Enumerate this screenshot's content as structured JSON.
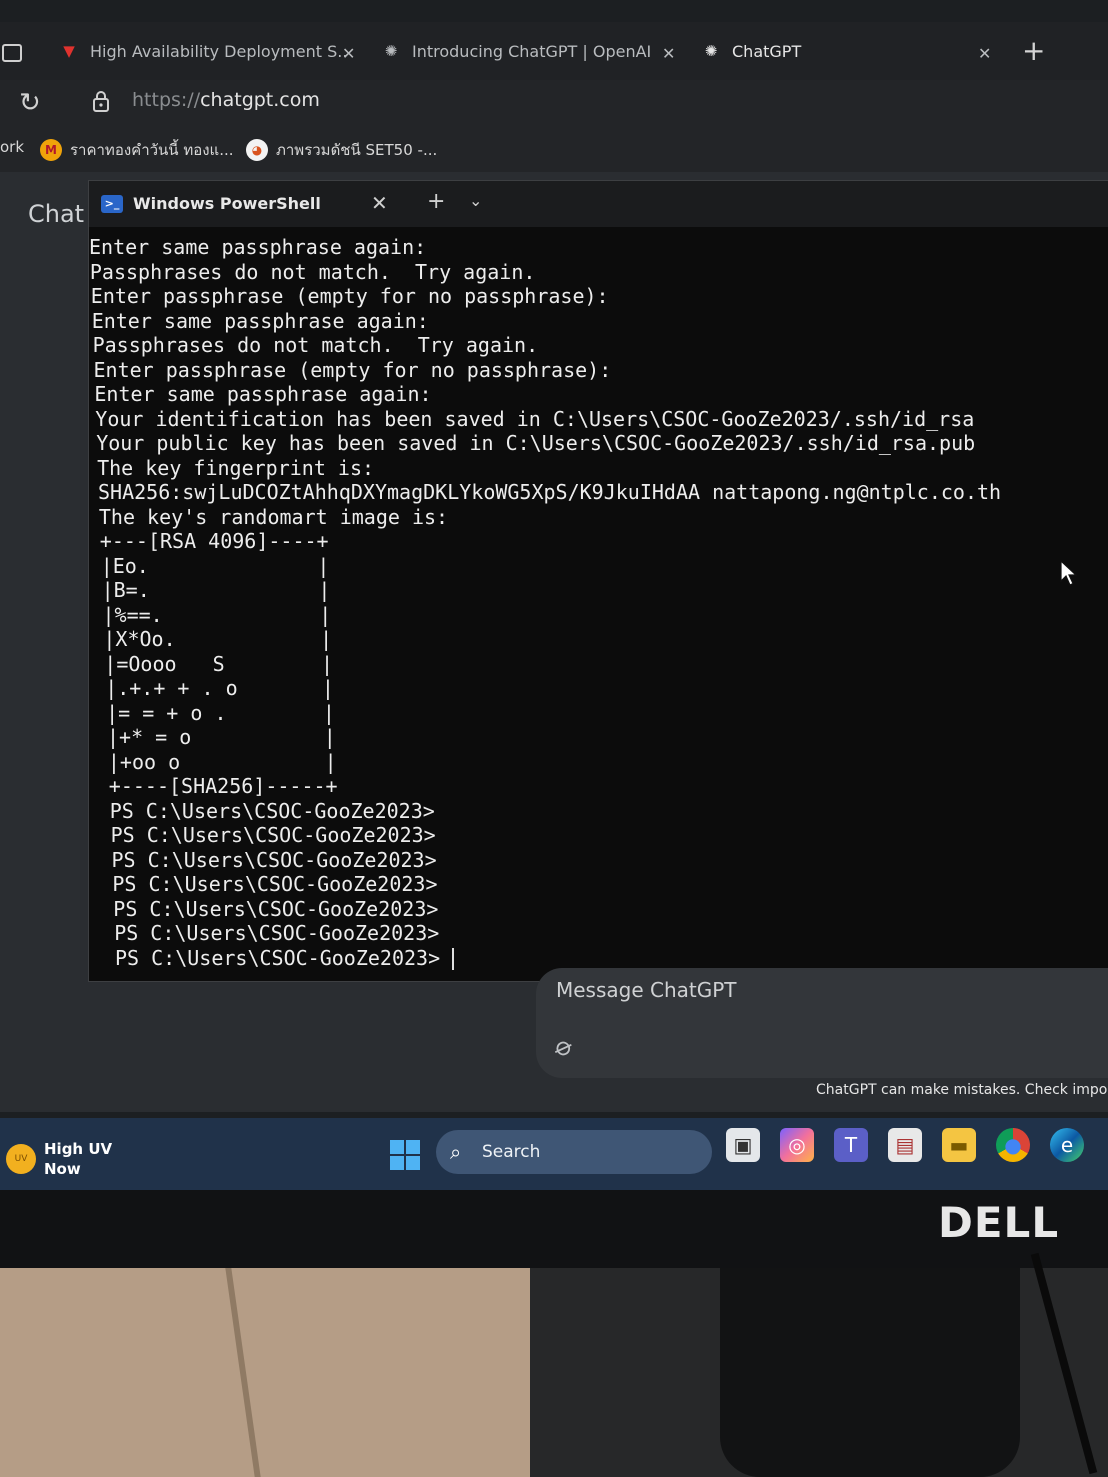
{
  "browser": {
    "tabs": [
      {
        "title": "High Availability Deployment S..",
        "icon": "red-bird-icon",
        "active": false
      },
      {
        "title": "Introducing ChatGPT | OpenAI",
        "icon": "openai-icon",
        "active": false
      },
      {
        "title": "ChatGPT",
        "icon": "openai-icon",
        "active": true
      }
    ],
    "url_protocol": "https://",
    "url_domain": "chatgpt.com",
    "bookmarks": [
      {
        "label": "ork",
        "icon": ""
      },
      {
        "label": "ราคาทองคำวันนี้ ทองแ...",
        "icon": "yellow-circle-icon"
      },
      {
        "label": "ภาพรวมดัชนี SET50 -...",
        "icon": "set-logo-icon"
      }
    ]
  },
  "page": {
    "chat_label": "Chat",
    "message_placeholder": "Message ChatGPT",
    "disclaimer": "ChatGPT can make mistakes. Check importar"
  },
  "terminal": {
    "title": "Windows PowerShell",
    "lines": [
      "Enter same passphrase again:",
      "Passphrases do not match.  Try again.",
      "Enter passphrase (empty for no passphrase):",
      "Enter same passphrase again:",
      "Passphrases do not match.  Try again.",
      "Enter passphrase (empty for no passphrase):",
      "Enter same passphrase again:",
      "Your identification has been saved in C:\\Users\\CSOC-GooZe2023/.ssh/id_rsa",
      "Your public key has been saved in C:\\Users\\CSOC-GooZe2023/.ssh/id_rsa.pub",
      "The key fingerprint is:",
      "SHA256:swjLuDCOZtAhhqDXYmagDKLYkoWG5XpS/K9JkuIHdAA nattapong.ng@ntplc.co.th",
      "The key's randomart image is:",
      "+---[RSA 4096]----+",
      "|Eo.              |",
      "|B=.              |",
      "|%==.             |",
      "|X*Oo.            |",
      "|=Oooo   S        |",
      "|.+.+ + . o       |",
      "|= = + o .        |",
      "|+* = o           |",
      "|+oo o            |",
      "+----[SHA256]-----+",
      "PS C:\\Users\\CSOC-GooZe2023>",
      "PS C:\\Users\\CSOC-GooZe2023>",
      "PS C:\\Users\\CSOC-GooZe2023>",
      "PS C:\\Users\\CSOC-GooZe2023>",
      "PS C:\\Users\\CSOC-GooZe2023>",
      "PS C:\\Users\\CSOC-GooZe2023>",
      "PS C:\\Users\\CSOC-GooZe2023>"
    ]
  },
  "taskbar": {
    "weather_line1": "High UV",
    "weather_line2": "Now",
    "weather_icon_text": "UV",
    "search_label": "Search",
    "pinned": [
      "task-view-icon",
      "copilot-icon",
      "teams-icon",
      "photos-icon",
      "file-explorer-icon",
      "chrome-icon",
      "edge-icon"
    ]
  },
  "monitor": {
    "brand": "DELL"
  }
}
